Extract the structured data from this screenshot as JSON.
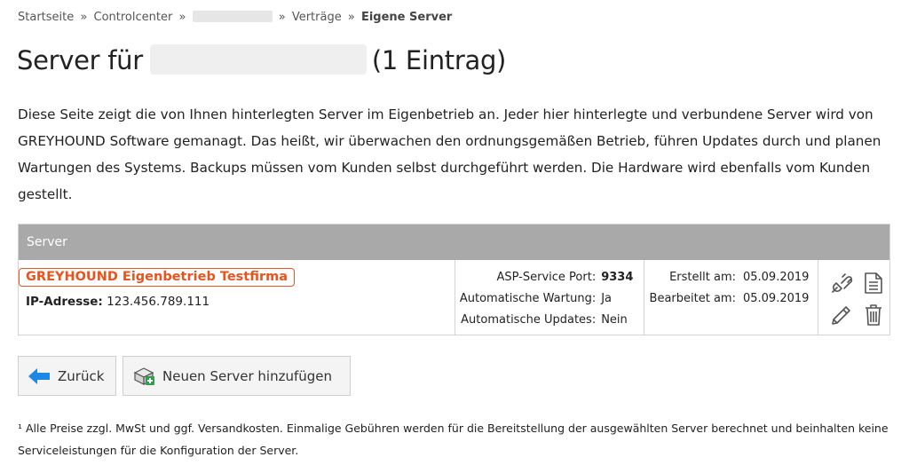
{
  "breadcrumb": {
    "home": "Startseite",
    "controlcenter": "Controlcenter",
    "contracts": "Verträge",
    "current": "Eigene Server",
    "separator": "»"
  },
  "title": {
    "prefix": "Server für",
    "suffix": "(1 Eintrag)"
  },
  "intro": "Diese Seite zeigt die von Ihnen hinterlegten Server im Eigenbetrieb an. Jeder hier hinterlegte und verbundene Server wird von GREYHOUND Software gemanagt. Das heißt, wir überwachen den ordnungsgemäßen Betrieb, führen Updates durch und planen Wartungen des Systems. Backups müssen vom Kunden selbst durchgeführt werden. Die Hardware wird ebenfalls vom Kunden gestellt.",
  "table": {
    "header": "Server",
    "rows": [
      {
        "name": "GREYHOUND Eigenbetrieb Testfirma",
        "ip_label": "IP-Adresse:",
        "ip_value": "123.456.789.111",
        "asp_port_label": "ASP-Service Port:",
        "asp_port_value": "9334",
        "auto_maint_label": "Automatische Wartung:",
        "auto_maint_value": "Ja",
        "auto_updates_label": "Automatische Updates:",
        "auto_updates_value": "Nein",
        "created_label": "Erstellt am:",
        "created_value": "05.09.2019",
        "edited_label": "Bearbeitet am:",
        "edited_value": "05.09.2019",
        "actions": [
          "plug-icon",
          "document-icon",
          "pencil-icon",
          "trash-icon"
        ]
      }
    ]
  },
  "buttons": {
    "back": "Zurück",
    "add_server": "Neuen Server hinzufügen"
  },
  "footnote": "¹ Alle Preise zzgl. MwSt und ggf. Versandkosten. Einmalige Gebühren werden für die Bereitstellung der ausgewählten Server berechnet und beinhalten keine Serviceleistungen für die Konfiguration der Server.",
  "colors": {
    "accent": "#e8541d",
    "table_header": "#a9a9a9",
    "back_arrow": "#1e88e5",
    "add_icon_green": "#2e9e4a"
  }
}
